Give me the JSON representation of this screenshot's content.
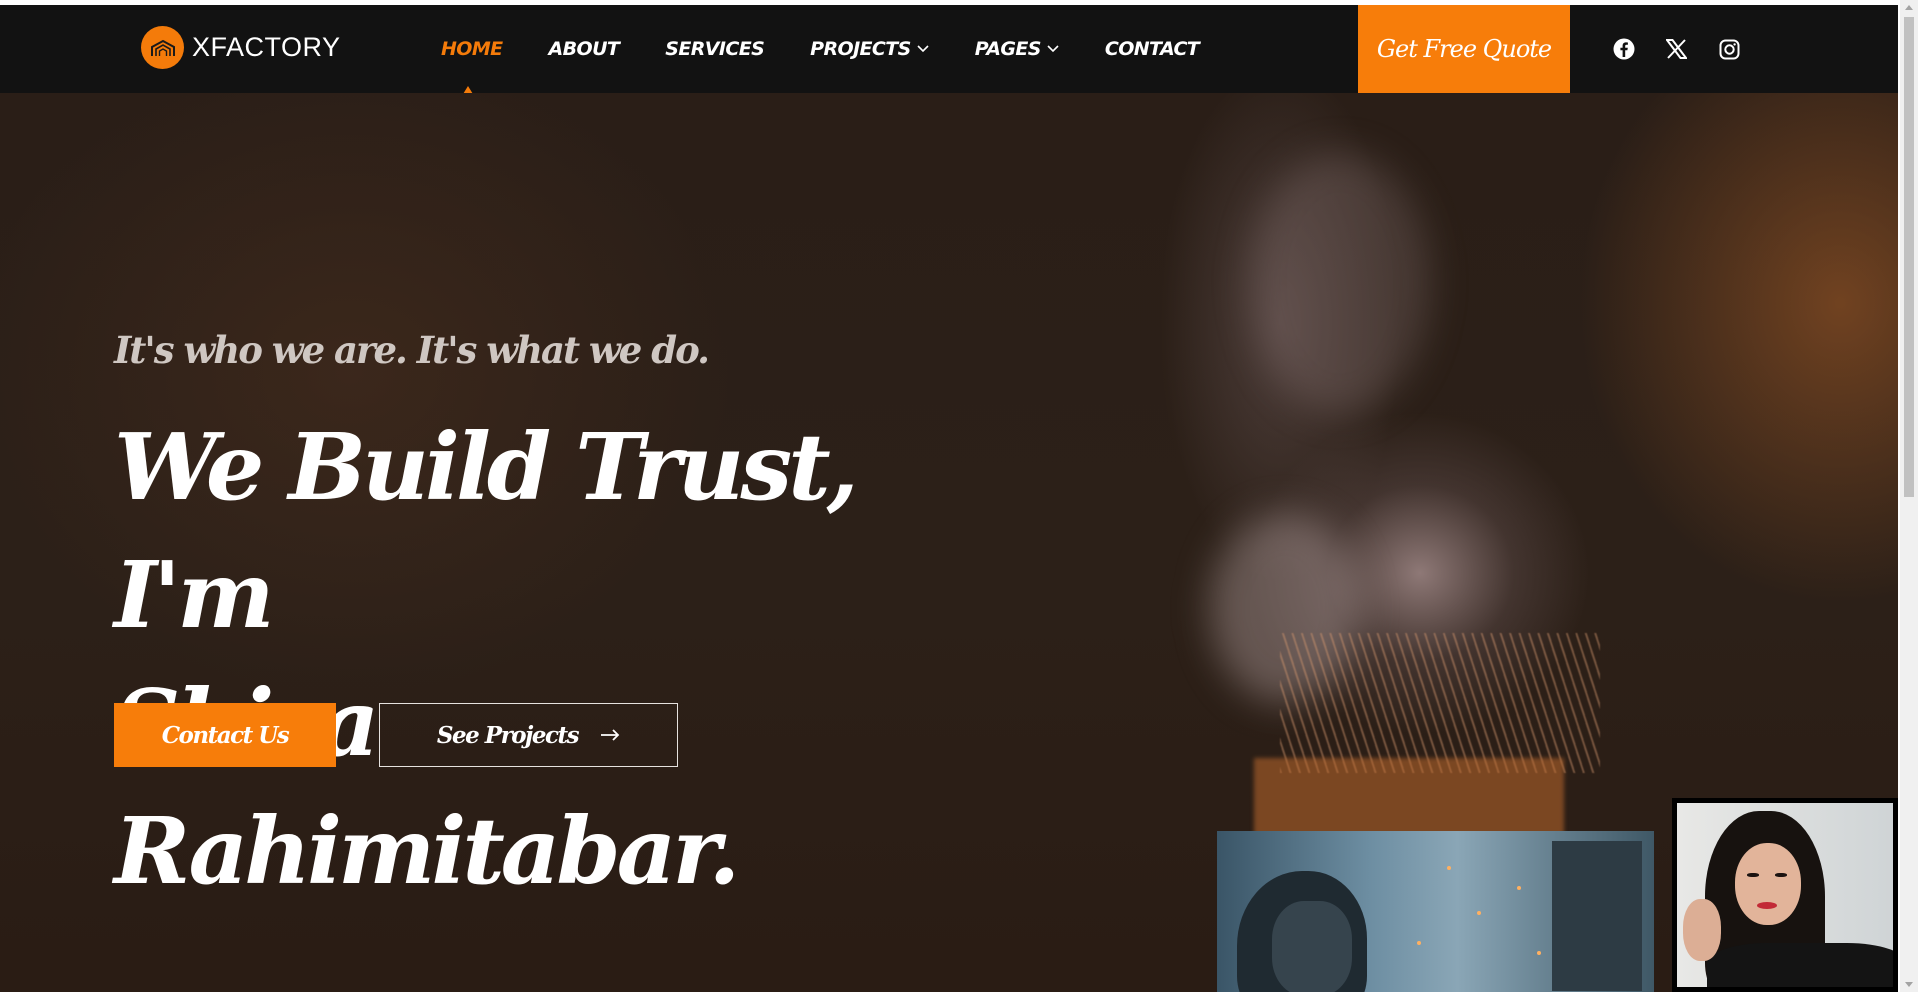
{
  "brand": {
    "name": "XFACTORY",
    "accent": "#F77D0A",
    "dark": "#121212"
  },
  "nav": {
    "items": [
      {
        "label": "HOME",
        "active": true,
        "dropdown": false
      },
      {
        "label": "ABOUT",
        "active": false,
        "dropdown": false
      },
      {
        "label": "SERVICES",
        "active": false,
        "dropdown": false
      },
      {
        "label": "PROJECTS",
        "active": false,
        "dropdown": true
      },
      {
        "label": "PAGES",
        "active": false,
        "dropdown": true
      },
      {
        "label": "CONTACT",
        "active": false,
        "dropdown": false
      }
    ],
    "quote_label": "Get Free Quote",
    "socials": [
      "facebook-icon",
      "x-twitter-icon",
      "instagram-icon"
    ]
  },
  "hero": {
    "tagline": "It's who we are. It's what we do.",
    "headline_line1": "We Build Trust, I'm",
    "headline_line2": "Shiva Rahimitabar.",
    "primary_button": "Contact Us",
    "secondary_button": "See Projects",
    "secondary_icon": "arrow-right-icon"
  }
}
